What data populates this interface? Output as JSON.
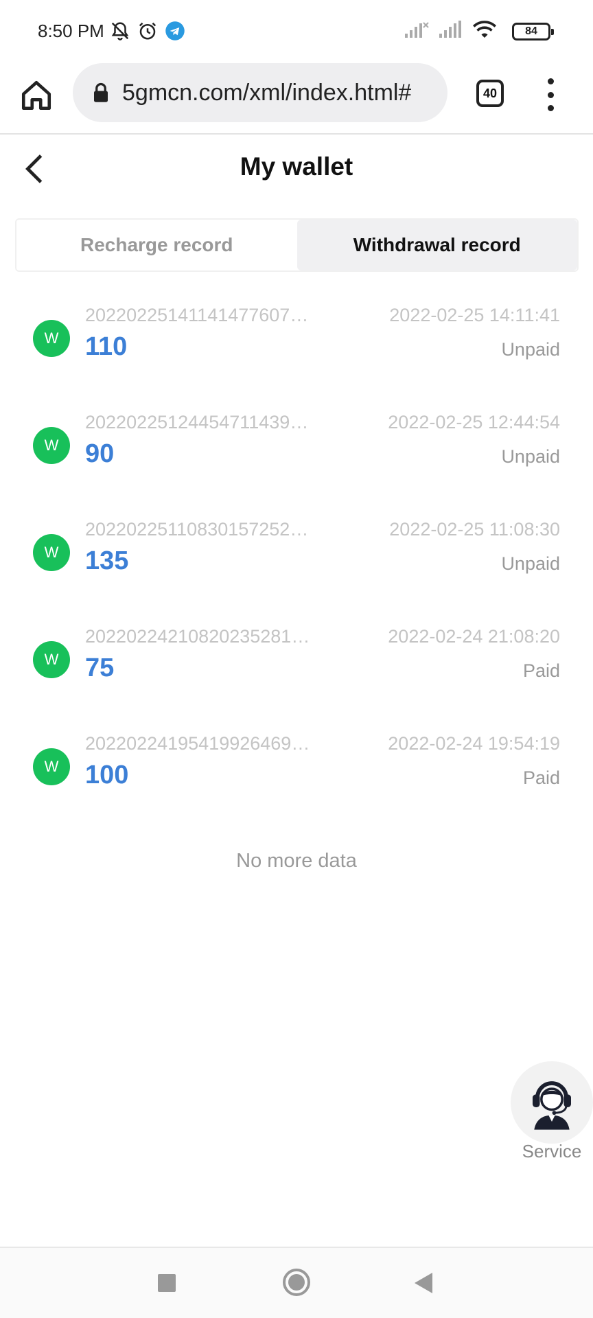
{
  "status_bar": {
    "time": "8:50 PM",
    "battery": "84",
    "icons_left": [
      "bell-off-icon",
      "alarm-icon",
      "telegram-icon"
    ],
    "icons_right": [
      "signal-x-icon",
      "signal-icon",
      "wifi-icon"
    ]
  },
  "browser": {
    "url": "5gmcn.com/xml/index.html#",
    "tab_count": "40"
  },
  "header": {
    "title": "My wallet"
  },
  "tabs": [
    {
      "label": "Recharge record",
      "active": false
    },
    {
      "label": "Withdrawal record",
      "active": true
    }
  ],
  "records": [
    {
      "avatar": "W",
      "id": "20220225141141477607…",
      "amount": "110",
      "time": "2022-02-25 14:11:41",
      "status": "Unpaid"
    },
    {
      "avatar": "W",
      "id": "20220225124454711439…",
      "amount": "90",
      "time": "2022-02-25 12:44:54",
      "status": "Unpaid"
    },
    {
      "avatar": "W",
      "id": "20220225110830157252…",
      "amount": "135",
      "time": "2022-02-25 11:08:30",
      "status": "Unpaid"
    },
    {
      "avatar": "W",
      "id": "20220224210820235281…",
      "amount": "75",
      "time": "2022-02-24 21:08:20",
      "status": "Paid"
    },
    {
      "avatar": "W",
      "id": "20220224195419926469…",
      "amount": "100",
      "time": "2022-02-24 19:54:19",
      "status": "Paid"
    }
  ],
  "footer": {
    "no_more": "No more data"
  },
  "service": {
    "label": "Service"
  },
  "colors": {
    "avatar_green": "#18c05a",
    "amount_blue": "#3c7fd6"
  }
}
